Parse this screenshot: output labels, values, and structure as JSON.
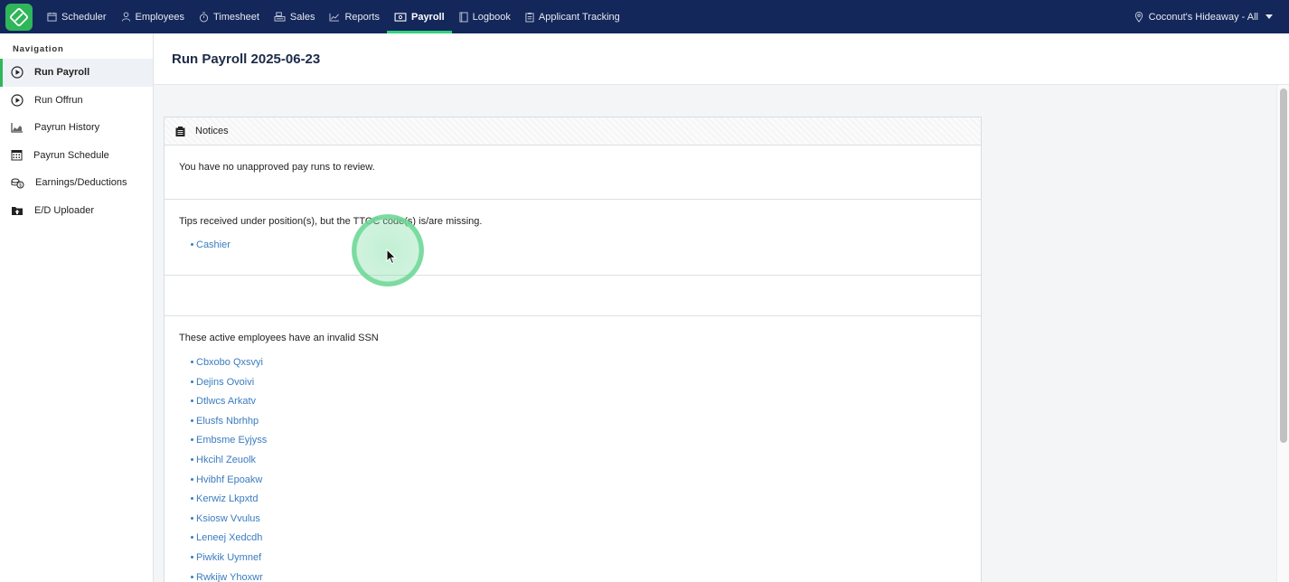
{
  "topnav": {
    "items": [
      {
        "label": "Scheduler",
        "icon": "calendar-icon"
      },
      {
        "label": "Employees",
        "icon": "person-icon"
      },
      {
        "label": "Timesheet",
        "icon": "stopwatch-icon"
      },
      {
        "label": "Sales",
        "icon": "register-icon"
      },
      {
        "label": "Reports",
        "icon": "chart-line-icon"
      },
      {
        "label": "Payroll",
        "icon": "money-icon",
        "active": true
      },
      {
        "label": "Logbook",
        "icon": "book-icon"
      },
      {
        "label": "Applicant Tracking",
        "icon": "clipboard-icon"
      }
    ],
    "location": "Coconut's Hideaway - All"
  },
  "sidebar": {
    "heading": "Navigation",
    "items": [
      {
        "label": "Run Payroll",
        "icon": "play-circle-icon",
        "active": true
      },
      {
        "label": "Run Offrun",
        "icon": "play-circle-icon"
      },
      {
        "label": "Payrun History",
        "icon": "area-chart-icon"
      },
      {
        "label": "Payrun Schedule",
        "icon": "calendar-grid-icon"
      },
      {
        "label": "Earnings/Deductions",
        "icon": "coins-icon"
      },
      {
        "label": "E/D Uploader",
        "icon": "folder-upload-icon"
      }
    ]
  },
  "page": {
    "title": "Run Payroll 2025-06-23"
  },
  "notices": {
    "header": "Notices",
    "unapproved": "You have no unapproved pay runs to review.",
    "tips_message": "Tips received under position(s), but the TTOC code(s) is/are missing.",
    "tips_positions": [
      "Cashier"
    ],
    "ssn_message": "These active employees have an invalid SSN",
    "ssn_employees": [
      "Cbxobo Qxsvyi",
      "Dejins Ovoivi",
      "Dtlwcs Arkatv",
      "Elusfs Nbrhhp",
      "Embsme Eyjyss",
      "Hkcihl Zeuolk",
      "Hvibhf Epoakw",
      "Kerwiz Lkpxtd",
      "Ksiosw Vvulus",
      "Leneej Xedcdh",
      "Piwkik Uymnef",
      "Rwkijw Yhoxwr"
    ]
  },
  "colors": {
    "topbar": "#13275a",
    "accent": "#2fb65a",
    "link": "#3a7cc0"
  }
}
